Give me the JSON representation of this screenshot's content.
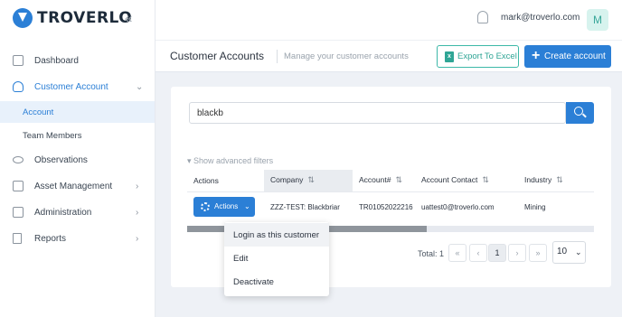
{
  "brand": {
    "name": "TROVERLO"
  },
  "sidebar": {
    "items": [
      {
        "label": "Dashboard",
        "icon": "chart-icon"
      },
      {
        "label": "Customer Account",
        "icon": "user-icon"
      },
      {
        "label": "Observations",
        "icon": "eye-icon"
      },
      {
        "label": "Asset Management",
        "icon": "edit-icon"
      },
      {
        "label": "Administration",
        "icon": "table-icon"
      },
      {
        "label": "Reports",
        "icon": "document-icon"
      }
    ],
    "subitems": [
      {
        "label": "Account"
      },
      {
        "label": "Team Members"
      }
    ]
  },
  "header": {
    "email": "mark@troverlo.com",
    "avatar_letter": "M"
  },
  "titlebar": {
    "title": "Customer Accounts",
    "subtitle": "Manage your customer accounts",
    "export_label": "Export To Excel",
    "create_label": "Create account"
  },
  "search": {
    "value": "blackb"
  },
  "filters": {
    "toggle_label": "Show advanced filters"
  },
  "table": {
    "headers": [
      "Actions",
      "Company",
      "Account#",
      "Account Contact",
      "Industry"
    ],
    "rows": [
      {
        "actions_label": "Actions",
        "company": "ZZZ-TEST: Blackbriar",
        "account": "TR01052022216",
        "contact": "uattest0@troverlo.com",
        "industry": "Mining"
      }
    ]
  },
  "pagination": {
    "total": "Total: 1",
    "current_page": "1",
    "per_page": "10"
  },
  "action_menu": {
    "items": [
      "Login as this customer",
      "Edit",
      "Deactivate"
    ]
  },
  "colors": {
    "accent": "#2b7fd6",
    "excel": "#2fa595"
  }
}
